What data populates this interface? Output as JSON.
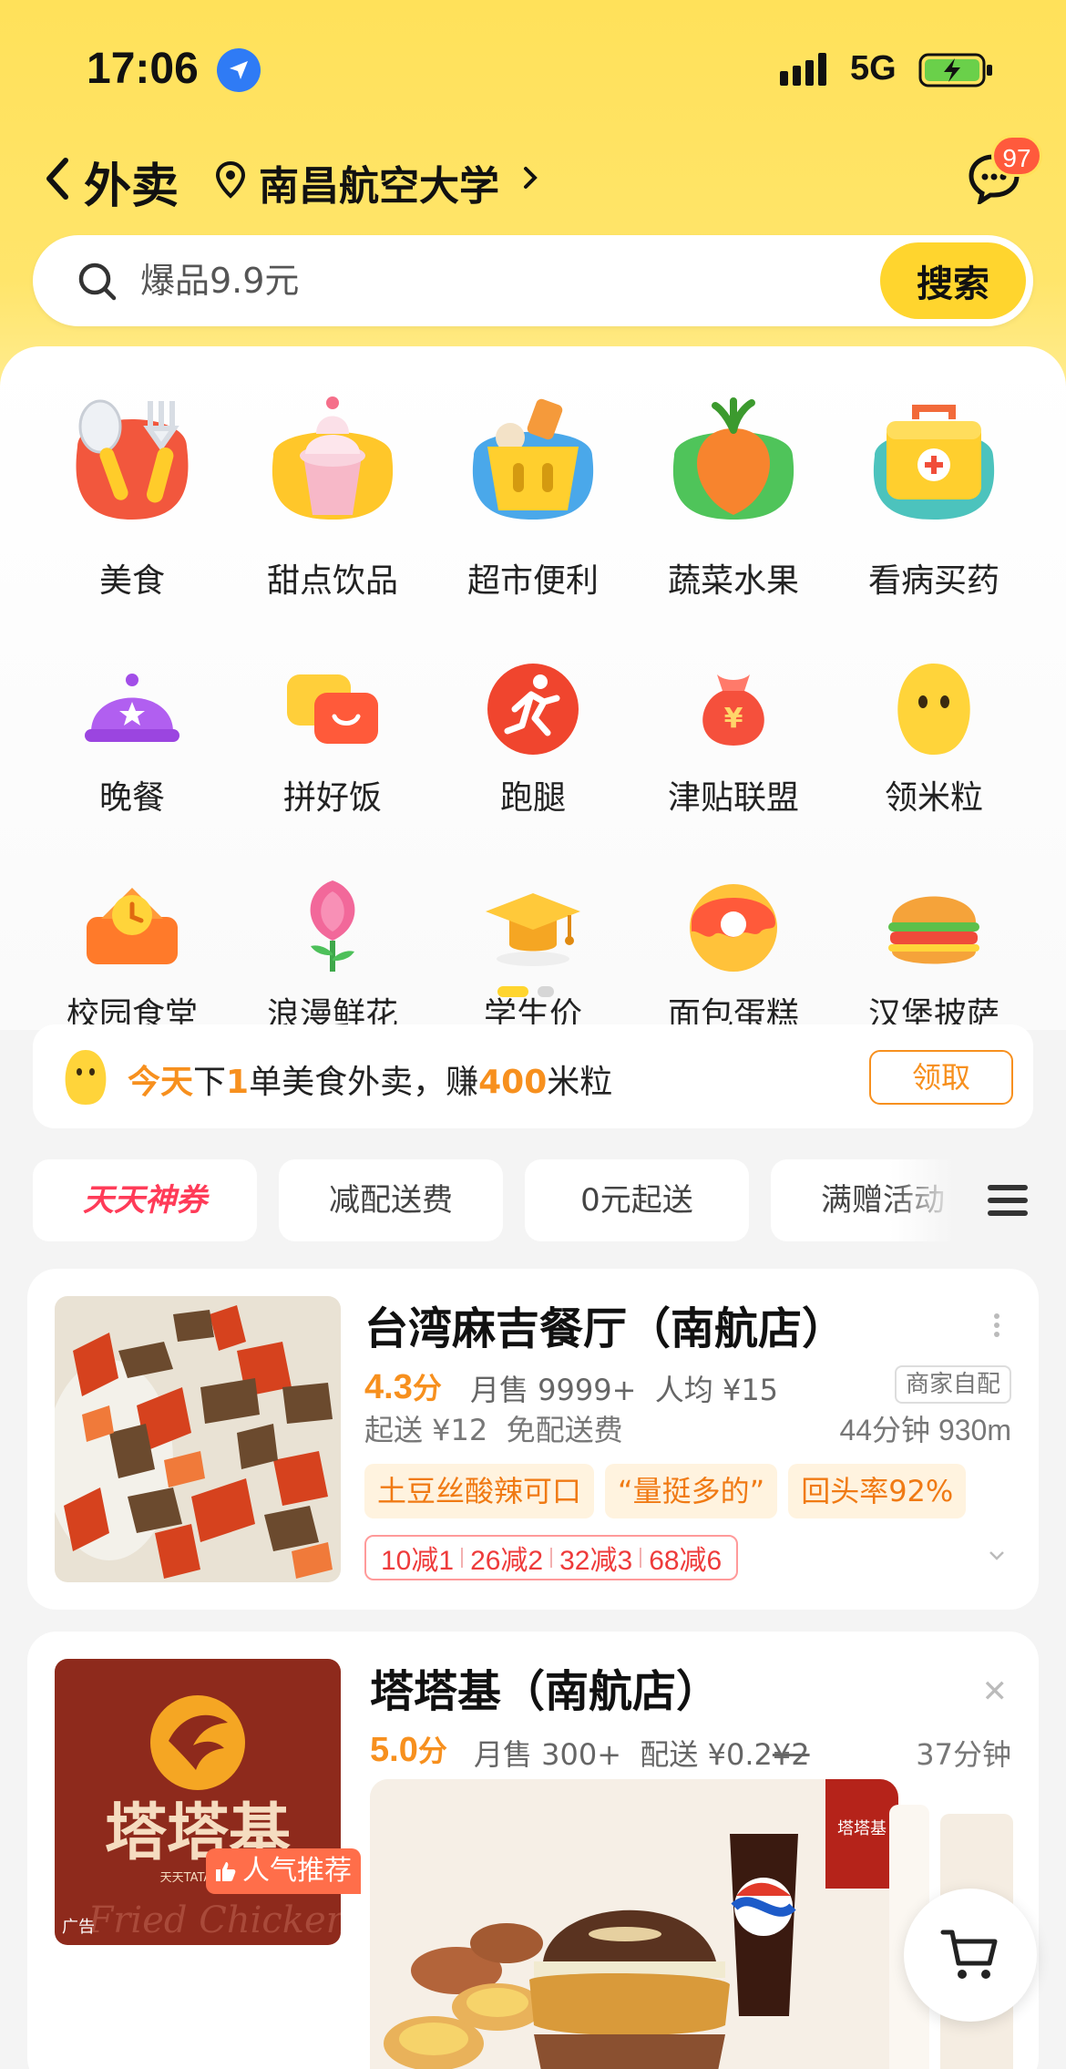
{
  "status_bar": {
    "time": "17:06",
    "network": "5G"
  },
  "header": {
    "title": "外卖",
    "location": "南昌航空大学",
    "message_badge": "97"
  },
  "search": {
    "placeholder": "爆品9.9元",
    "button_label": "搜索"
  },
  "categories": [
    {
      "label": "美食",
      "icon": "utensils-icon"
    },
    {
      "label": "甜点饮品",
      "icon": "ice-cream-icon"
    },
    {
      "label": "超市便利",
      "icon": "shopping-basket-icon"
    },
    {
      "label": "蔬菜水果",
      "icon": "carrot-icon"
    },
    {
      "label": "看病买药",
      "icon": "medicine-box-icon"
    },
    {
      "label": "晚餐",
      "icon": "dinner-dome-icon"
    },
    {
      "label": "拼好饭",
      "icon": "group-meal-icon"
    },
    {
      "label": "跑腿",
      "icon": "runner-icon"
    },
    {
      "label": "津贴联盟",
      "icon": "money-bag-icon"
    },
    {
      "label": "领米粒",
      "icon": "rice-grain-icon"
    },
    {
      "label": "校园食堂",
      "icon": "canteen-clock-icon"
    },
    {
      "label": "浪漫鲜花",
      "icon": "flower-icon"
    },
    {
      "label": "学生价",
      "icon": "graduation-cap-icon"
    },
    {
      "label": "面包蛋糕",
      "icon": "donut-icon"
    },
    {
      "label": "汉堡披萨",
      "icon": "burger-icon"
    }
  ],
  "promo": {
    "part1": "今天",
    "part2": "下",
    "part3": "1",
    "part4": "单美食外卖，赚",
    "part5": "400",
    "part6": "米粒",
    "button_label": "领取"
  },
  "filters": [
    "天天神券",
    "减配送费",
    "0元起送",
    "满赠活动"
  ],
  "stores": [
    {
      "name": "台湾麻吉餐厅（南航店）",
      "rating": "4.3",
      "rating_unit": "分",
      "monthly_sales": "月售 9999+",
      "avg_price": "人均 ¥15",
      "delivery_type": "商家自配",
      "min_order": "起送 ¥12",
      "delivery_fee": "免配送费",
      "eta_distance": "44分钟 930m",
      "tags": [
        "土豆丝酸辣可口",
        "“量挺多的”",
        "回头率92%"
      ],
      "discounts": [
        "10减1",
        "26减2",
        "32减3",
        "68减6"
      ]
    },
    {
      "name": "塔塔基（南航店）",
      "rating": "5.0",
      "rating_unit": "分",
      "monthly_sales": "月售 300+",
      "delivery_label": "配送 ¥0.2",
      "delivery_original": "¥2",
      "eta": "37分钟",
      "popular_label": "人气推荐",
      "ad_label": "广告",
      "logo_text": "塔塔基",
      "logo_subtext": "天天TATAJI DAYDAY更开心",
      "logo_script": "Fried Chicken"
    }
  ],
  "colors": {
    "accent_yellow": "#ffd52e",
    "rating_orange": "#f7901e",
    "discount_red": "#ee3b3b"
  }
}
